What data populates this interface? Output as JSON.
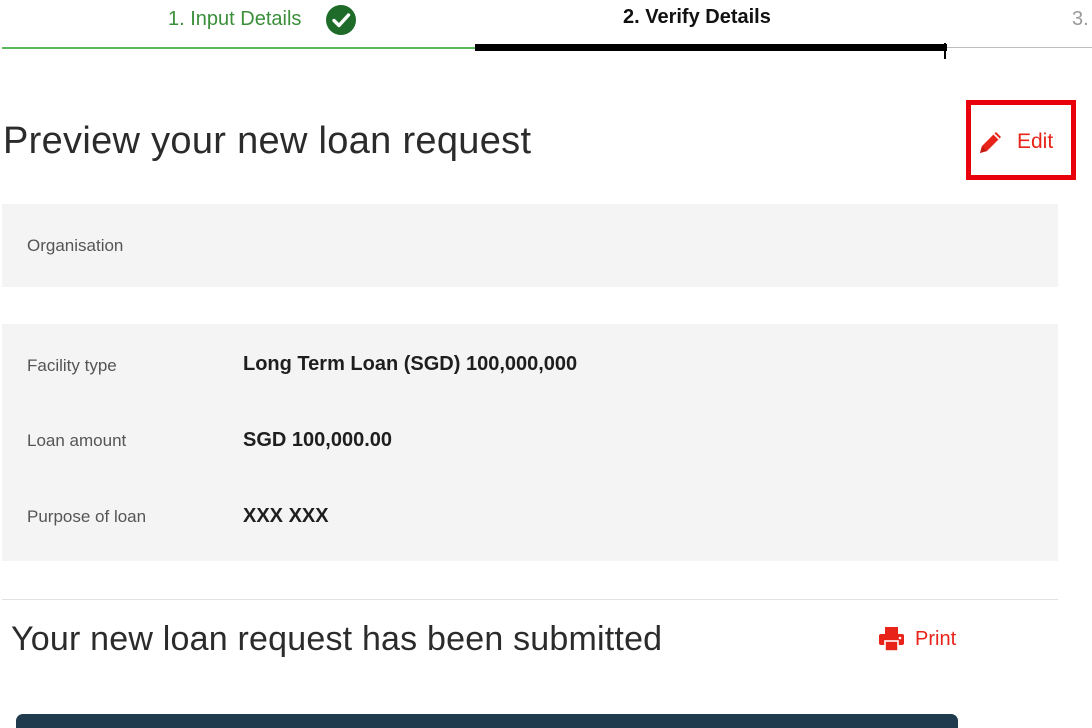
{
  "stepper": {
    "steps": [
      {
        "label": "1. Input Details",
        "state": "complete"
      },
      {
        "label": "2. Verify Details",
        "state": "active"
      },
      {
        "label": "3.",
        "state": "upcoming"
      }
    ]
  },
  "preview": {
    "title": "Preview your new loan request",
    "edit_label": "Edit"
  },
  "organisation": {
    "label": "Organisation",
    "value": ""
  },
  "details": [
    {
      "label": "Facility type",
      "value": "Long Term Loan (SGD) 100,000,000"
    },
    {
      "label": "Loan amount",
      "value": "SGD 100,000.00"
    },
    {
      "label": "Purpose of loan",
      "value": "XXX XXX"
    }
  ],
  "submission": {
    "title": "Your new loan request has been submitted",
    "print_label": "Print"
  },
  "colors": {
    "accent_red": "#e8231a",
    "highlight_red": "#e8000b",
    "complete_green": "#1e6b2a",
    "card_bg": "#f4f4f4"
  },
  "icons": {
    "step_complete": "check-circle-icon",
    "edit": "pencil-icon",
    "print": "printer-icon"
  }
}
